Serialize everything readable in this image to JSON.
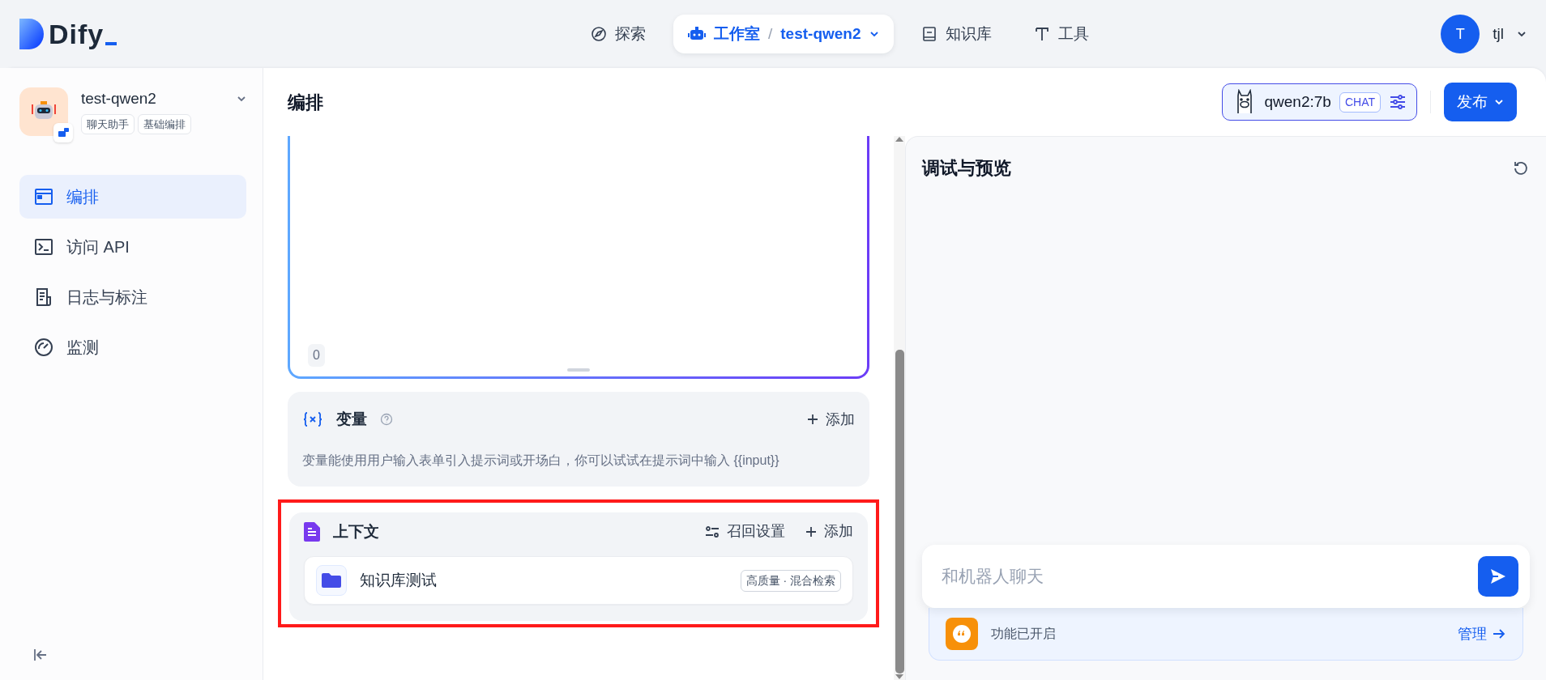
{
  "header": {
    "logo": "Dify",
    "nav": [
      {
        "kind": "explore",
        "label": "探索",
        "selected": false
      },
      {
        "kind": "studio",
        "label": "工作室",
        "selected": true,
        "separator": "/",
        "app": "test-qwen2"
      },
      {
        "kind": "datasets",
        "label": "知识库",
        "selected": false
      },
      {
        "kind": "tools",
        "label": "工具",
        "selected": false
      }
    ],
    "user": {
      "initial": "T",
      "name": "tjl"
    }
  },
  "sidebar": {
    "app_name": "test-qwen2",
    "tags": [
      "聊天助手",
      "基础编排"
    ],
    "items": [
      {
        "kind": "layout",
        "label": "编排",
        "selected": true
      },
      {
        "kind": "terminal",
        "label": "访问 API",
        "selected": false
      },
      {
        "kind": "log",
        "label": "日志与标注",
        "selected": false
      },
      {
        "kind": "gauge",
        "label": "监测",
        "selected": false
      }
    ]
  },
  "main": {
    "title": "编排",
    "prompt": {
      "count": "0"
    },
    "variables": {
      "title": "变量",
      "add": "添加",
      "description": "变量能使用用户输入表单引入提示词或开场白，你可以试试在提示词中输入 {{input}}"
    },
    "context": {
      "title": "上下文",
      "settings": "召回设置",
      "add": "添加",
      "highlighted": true,
      "datasets": [
        {
          "name": "知识库测试",
          "tag": "高质量 · 混合检索"
        }
      ]
    }
  },
  "model": {
    "name": "qwen2:7b",
    "mode": "CHAT"
  },
  "publish": "发布",
  "preview": {
    "title": "调试与预览",
    "input": {
      "placeholder": "和机器人聊天"
    },
    "features": {
      "text": "功能已开启",
      "manage": "管理"
    }
  }
}
